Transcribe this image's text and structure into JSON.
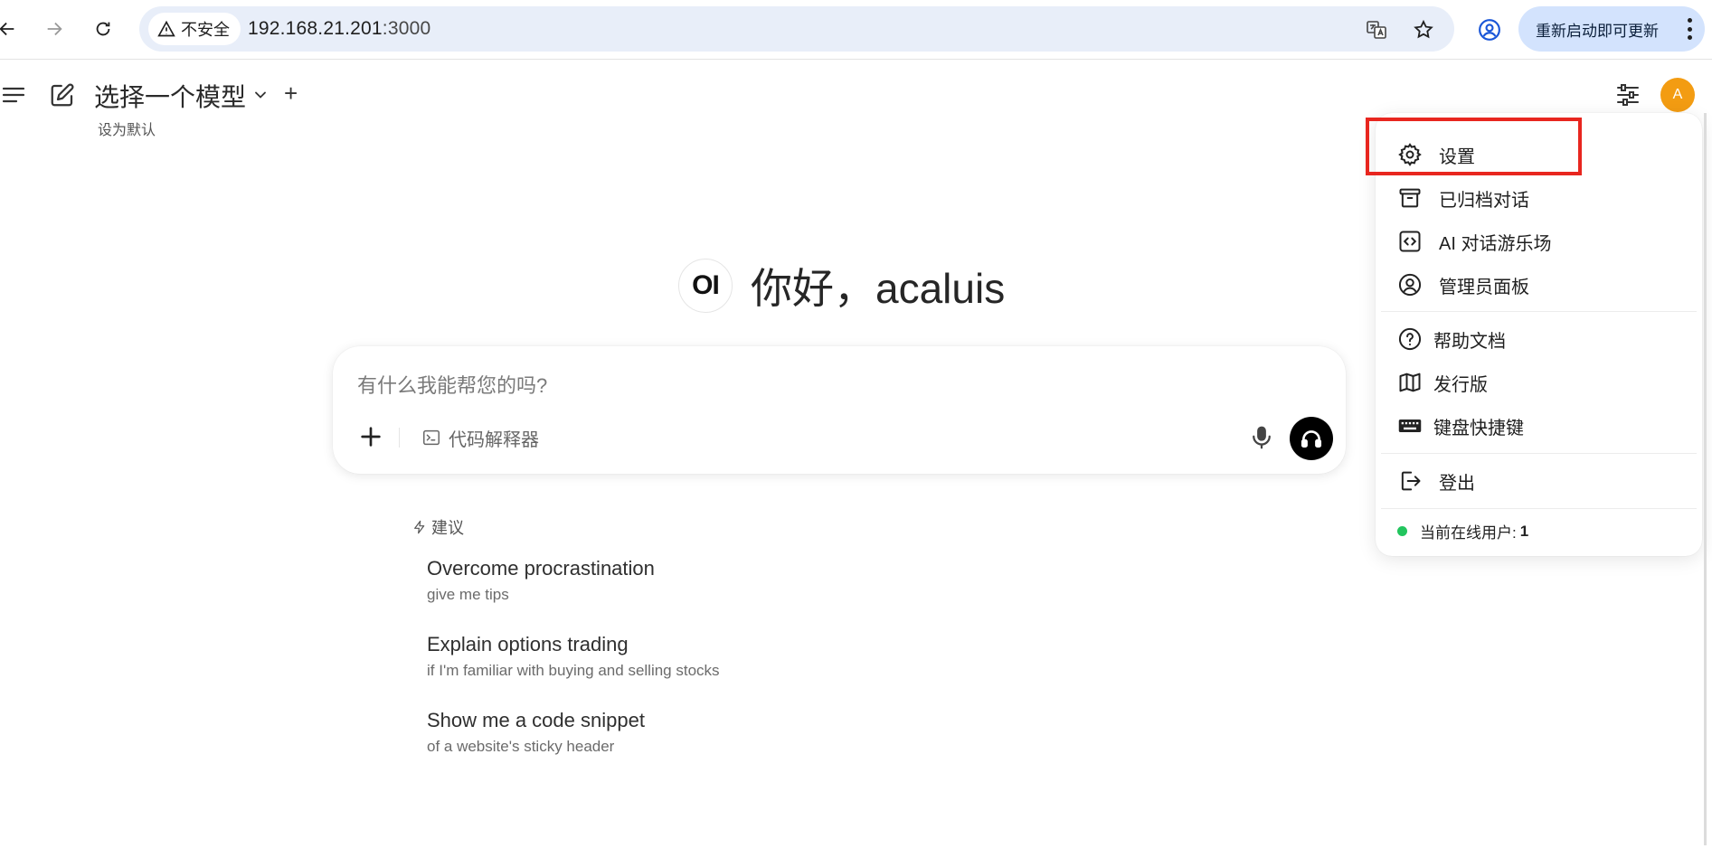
{
  "browser": {
    "security_label": "不安全",
    "url_host": "192.168.21.201",
    "url_port": ":3000",
    "update_button": "重新启动即可更新"
  },
  "header": {
    "model_title": "选择一个模型",
    "add_label": "+",
    "set_default": "设为默认",
    "avatar_initial": "A"
  },
  "greeting": {
    "logo_text": "OI",
    "text": "你好，acaluis"
  },
  "composer": {
    "placeholder": "有什么我能帮您的吗?",
    "code_interpreter": "代码解释器"
  },
  "suggestions": {
    "label": "建议",
    "items": [
      {
        "title": "Overcome procrastination",
        "subtitle": "give me tips"
      },
      {
        "title": "Explain options trading",
        "subtitle": "if I'm familiar with buying and selling stocks"
      },
      {
        "title": "Show me a code snippet",
        "subtitle": "of a website's sticky header"
      }
    ]
  },
  "menu": {
    "items": [
      {
        "label": "设置",
        "icon": "gear-icon"
      },
      {
        "label": "已归档对话",
        "icon": "archive-icon"
      },
      {
        "label": "AI 对话游乐场",
        "icon": "code-icon"
      },
      {
        "label": "管理员面板",
        "icon": "user-circle-icon"
      },
      {
        "label": "帮助文档",
        "icon": "help-icon"
      },
      {
        "label": "发行版",
        "icon": "map-icon"
      },
      {
        "label": "键盘快捷键",
        "icon": "keyboard-icon"
      },
      {
        "label": "登出",
        "icon": "logout-icon"
      }
    ],
    "online_label": "当前在线用户:",
    "online_count": "1",
    "online_color": "#22c55e",
    "highlight_color": "#e8261f"
  }
}
